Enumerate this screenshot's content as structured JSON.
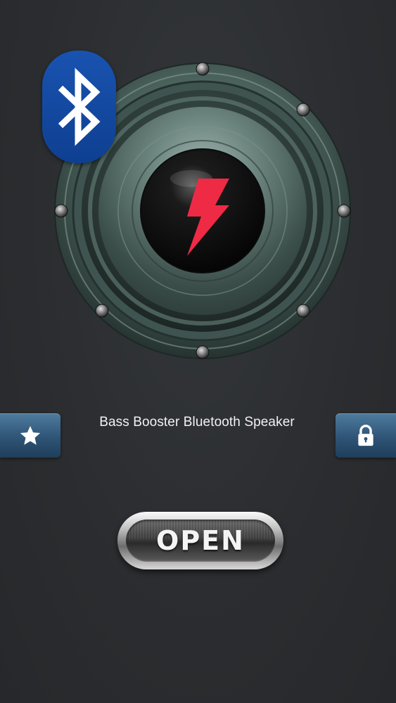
{
  "app": {
    "title": "Bass Booster Bluetooth Speaker"
  },
  "buttons": {
    "favorite_icon": "star-icon",
    "lock_icon": "lock-icon",
    "open_label": "OPEN"
  },
  "graphics": {
    "speaker": "subwoofer-speaker-graphic",
    "center_icon": "lightning-bolt-icon",
    "badge_icon": "bluetooth-icon"
  },
  "colors": {
    "background": "#2b2d30",
    "bluetooth_blue": "#1953b0",
    "bolt_red": "#ef2a45",
    "side_button_blue": "#2e5476",
    "speaker_green": "#4d6560"
  }
}
